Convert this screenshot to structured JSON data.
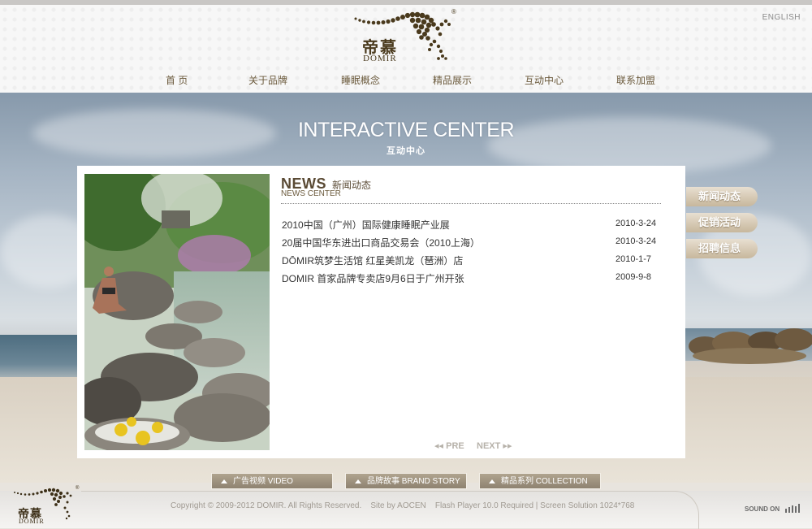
{
  "header": {
    "english_link": "ENGLISH",
    "logo_cn": "帝慕",
    "logo_en": "DŌMIR",
    "logo_reg": "®"
  },
  "nav": {
    "items": [
      {
        "label": "首  页"
      },
      {
        "label": "关于品牌"
      },
      {
        "label": "睡眠概念"
      },
      {
        "label": "精品展示"
      },
      {
        "label": "互动中心"
      },
      {
        "label": "联系加盟"
      }
    ]
  },
  "page": {
    "title": "INTERACTIVE CENTER",
    "subtitle": "互动中心"
  },
  "news": {
    "title_en": "NEWS",
    "title_cn": "新闻动态",
    "subtitle": "NEWS CENTER",
    "items": [
      {
        "text": "2010中国（广州）国际健康睡眠产业展",
        "date": "2010-3-24"
      },
      {
        "text": "20届中国华东进出口商品交易会（2010上海）",
        "date": "2010-3-24"
      },
      {
        "text": "DŌMIR筑梦生活馆 红星美凯龙（琶洲）店",
        "date": "2010-1-7"
      },
      {
        "text": "DOMIR 首家品牌专卖店9月6日于广州开张",
        "date": "2009-9-8"
      }
    ],
    "pager_prev": "PRE",
    "pager_next": "NEXT"
  },
  "side_menu": {
    "items": [
      {
        "label": "新闻动态"
      },
      {
        "label": "促销活动"
      },
      {
        "label": "招聘信息"
      }
    ]
  },
  "bottom_tabs": {
    "items": [
      {
        "label": "广告视频    VIDEO"
      },
      {
        "label": "品牌故事  BRAND STORY"
      },
      {
        "label": "精品系列  COLLECTION"
      }
    ]
  },
  "footer": {
    "logo_cn": "帝慕",
    "logo_en": "DŌMIR",
    "logo_reg": "®",
    "copyright": "Copyright © 2009-2012 DOMIR. All Rights Reserved.    Site by AOCEN    Flash Player 10.0 Required | Screen Solution 1024*768",
    "sound": "SOUND ON"
  },
  "colors": {
    "brand_brown": "#5a4a34",
    "nav_text": "#6b5a3c",
    "side_button": "#c7b79c"
  }
}
